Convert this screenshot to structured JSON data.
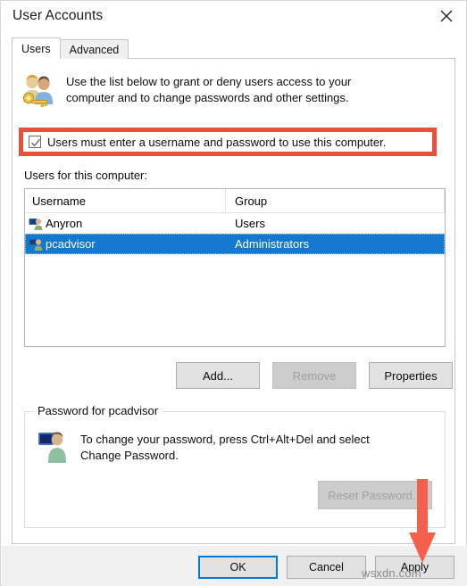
{
  "window": {
    "title": "User Accounts",
    "close_icon": "close-icon"
  },
  "tabs": [
    {
      "label": "Users",
      "active": true
    },
    {
      "label": "Advanced",
      "active": false
    }
  ],
  "intro": {
    "icon": "users-key-icon",
    "line1": "Use the list below to grant or deny users access to your",
    "line2": "computer and to change passwords and other settings."
  },
  "checkbox": {
    "label": "Users must enter a username and password to use this computer.",
    "checked": true,
    "highlight_color": "#e8503a"
  },
  "list": {
    "caption": "Users for this computer:",
    "columns": [
      "Username",
      "Group"
    ],
    "rows": [
      {
        "username": "Anyron",
        "group": "Users",
        "selected": false
      },
      {
        "username": "pcadvisor",
        "group": "Administrators",
        "selected": true
      }
    ],
    "selection_color": "#1378ce"
  },
  "row_actions": [
    {
      "label": "Add...",
      "disabled": false
    },
    {
      "label": "Remove",
      "disabled": true
    },
    {
      "label": "Properties",
      "disabled": false
    }
  ],
  "password_group": {
    "title": "Password for pcadvisor",
    "icon": "user-monitor-icon",
    "line1": "To change your password, press Ctrl+Alt+Del and select",
    "line2": "Change Password.",
    "reset_button": {
      "label": "Reset Password...",
      "disabled": true
    }
  },
  "footer_buttons": [
    {
      "label": "OK",
      "default": true
    },
    {
      "label": "Cancel",
      "default": false
    },
    {
      "label": "Apply",
      "default": false
    }
  ],
  "annotations": {
    "arrow": {
      "name": "red-arrow-pointing-to-apply",
      "color": "#f4604c"
    },
    "watermark": "wsxdn.com"
  }
}
